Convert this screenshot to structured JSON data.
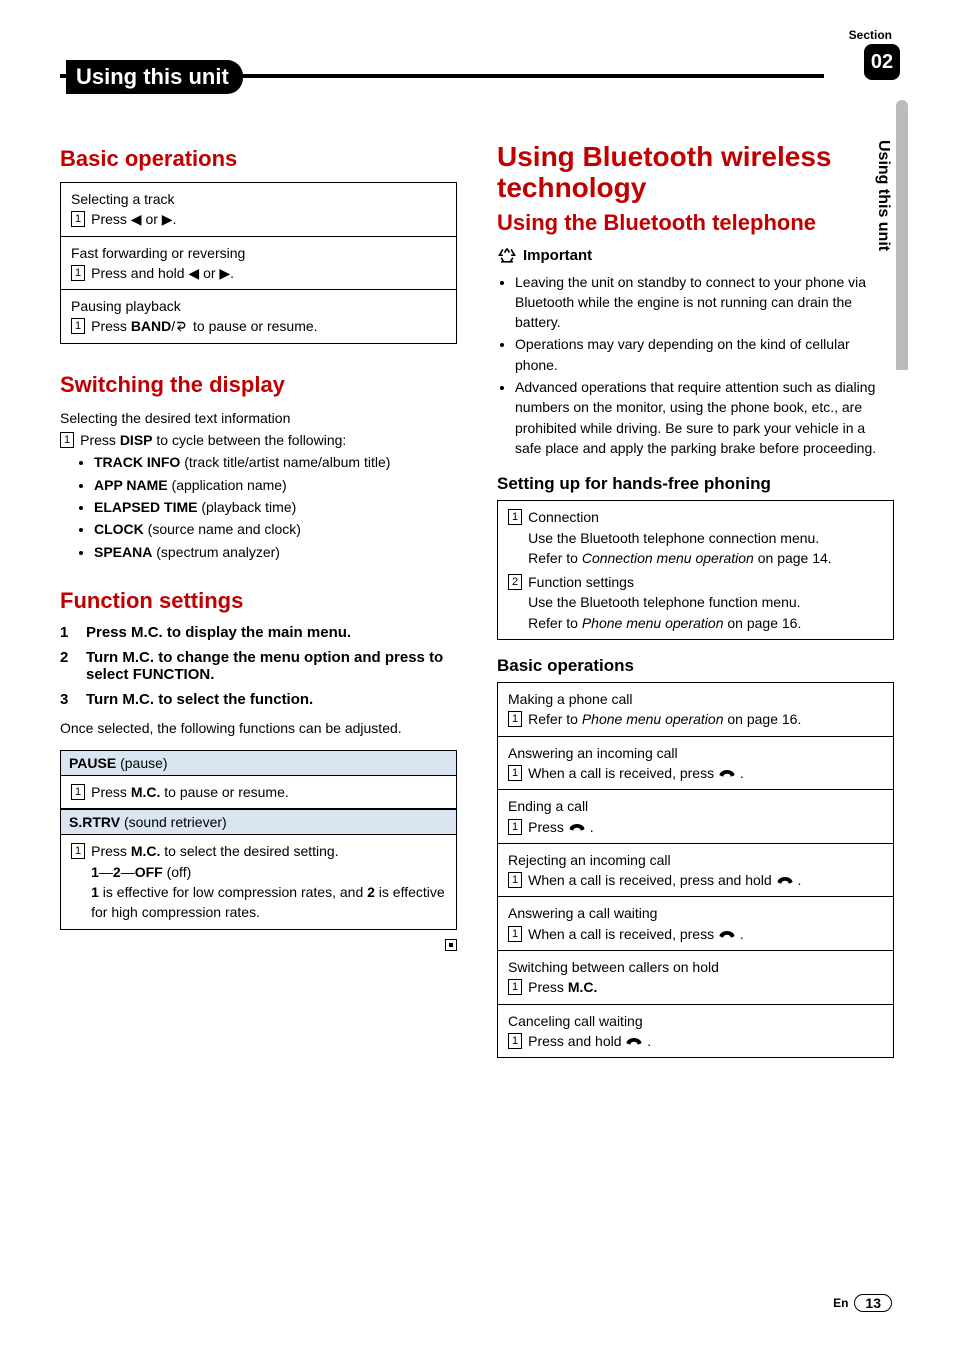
{
  "header": {
    "section_label": "Section",
    "section_num": "02",
    "tab": "Using this unit",
    "side_tab": "Using this unit"
  },
  "left": {
    "h_basic": "Basic operations",
    "box1_t": "Selecting a track",
    "box1_s": "Press ◀ or ▶.",
    "box2_t": "Fast forwarding or reversing",
    "box2_s": "Press and hold ◀ or ▶.",
    "box3_t": "Pausing playback",
    "box3_s_a": "Press ",
    "box3_s_b": "BAND",
    "box3_s_c": "/",
    "box3_s_d": " to pause or resume.",
    "h_switch": "Switching the display",
    "sw_lead": "Selecting the desired text information",
    "sw_step_a": "Press ",
    "sw_step_b": "DISP",
    "sw_step_c": " to cycle between the following:",
    "sw_items": [
      {
        "b": "TRACK INFO",
        "d": " (track title/artist name/album title)"
      },
      {
        "b": "APP NAME",
        "d": " (application name)"
      },
      {
        "b": "ELAPSED TIME",
        "d": " (playback time)"
      },
      {
        "b": "CLOCK",
        "d": " (source name and clock)"
      },
      {
        "b": "SPEANA",
        "d": " (spectrum analyzer)"
      }
    ],
    "h_func": "Function settings",
    "fs1": "Press M.C. to display the main menu.",
    "fs2": "Turn M.C. to change the menu option and press to select FUNCTION.",
    "fs3": "Turn M.C. to select the function.",
    "fs_after": "Once selected, the following functions can be adjusted.",
    "pause_h_a": "PAUSE",
    "pause_h_b": " (pause)",
    "pause_b_a": "Press ",
    "pause_b_b": "M.C.",
    "pause_b_c": " to pause or resume.",
    "srtrv_h_a": "S.RTRV",
    "srtrv_h_b": " (sound retriever)",
    "srtrv_b1_a": "Press ",
    "srtrv_b1_b": "M.C.",
    "srtrv_b1_c": " to select the desired setting.",
    "srtrv_b2_a": "1",
    "srtrv_b2_b": "—",
    "srtrv_b2_c": "2",
    "srtrv_b2_d": "—",
    "srtrv_b2_e": "OFF",
    "srtrv_b2_f": " (off)",
    "srtrv_b3_a": "1",
    "srtrv_b3_b": " is effective for low compression rates, and ",
    "srtrv_b3_c": "2",
    "srtrv_b3_d": " is effective for high compression rates."
  },
  "right": {
    "h_bt": "Using Bluetooth wireless technology",
    "h_bt_phone": "Using the Bluetooth telephone",
    "important": "Important",
    "imp1": "Leaving the unit on standby to connect to your phone via Bluetooth while the engine is not running can drain the battery.",
    "imp2": "Operations may vary depending on the kind of cellular phone.",
    "imp3": "Advanced operations that require attention such as dialing numbers on the monitor, using the phone book, etc., are prohibited while driving. Be sure to park your vehicle in a safe place and apply the parking brake before proceeding.",
    "h_setup": "Setting up for hands-free phoning",
    "s1_t": "Connection",
    "s1_a": "Use the Bluetooth telephone connection menu.",
    "s1_b_a": "Refer to ",
    "s1_b_i": "Connection menu operation",
    "s1_b_c": " on page 14.",
    "s2_t": "Function settings",
    "s2_a": "Use the Bluetooth telephone function menu.",
    "s2_b_a": "Refer to ",
    "s2_b_i": "Phone menu operation",
    "s2_b_c": " on page 16.",
    "h_basic2": "Basic operations",
    "b1_t": "Making a phone call",
    "b1_a": "Refer to ",
    "b1_i": "Phone menu operation",
    "b1_c": " on page 16.",
    "b2_t": "Answering an incoming call",
    "b2_s": "When a call is received, press ",
    "b3_t": "Ending a call",
    "b3_s": "Press ",
    "b4_t": "Rejecting an incoming call",
    "b4_s": "When a call is received, press and hold ",
    "b5_t": "Answering a call waiting",
    "b5_s": "When a call is received, press ",
    "b6_t": "Switching between callers on hold",
    "b6_s_a": "Press ",
    "b6_s_b": "M.C.",
    "b7_t": "Canceling call waiting",
    "b7_s": "Press and hold "
  },
  "footer": {
    "lang": "En",
    "page": "13"
  }
}
